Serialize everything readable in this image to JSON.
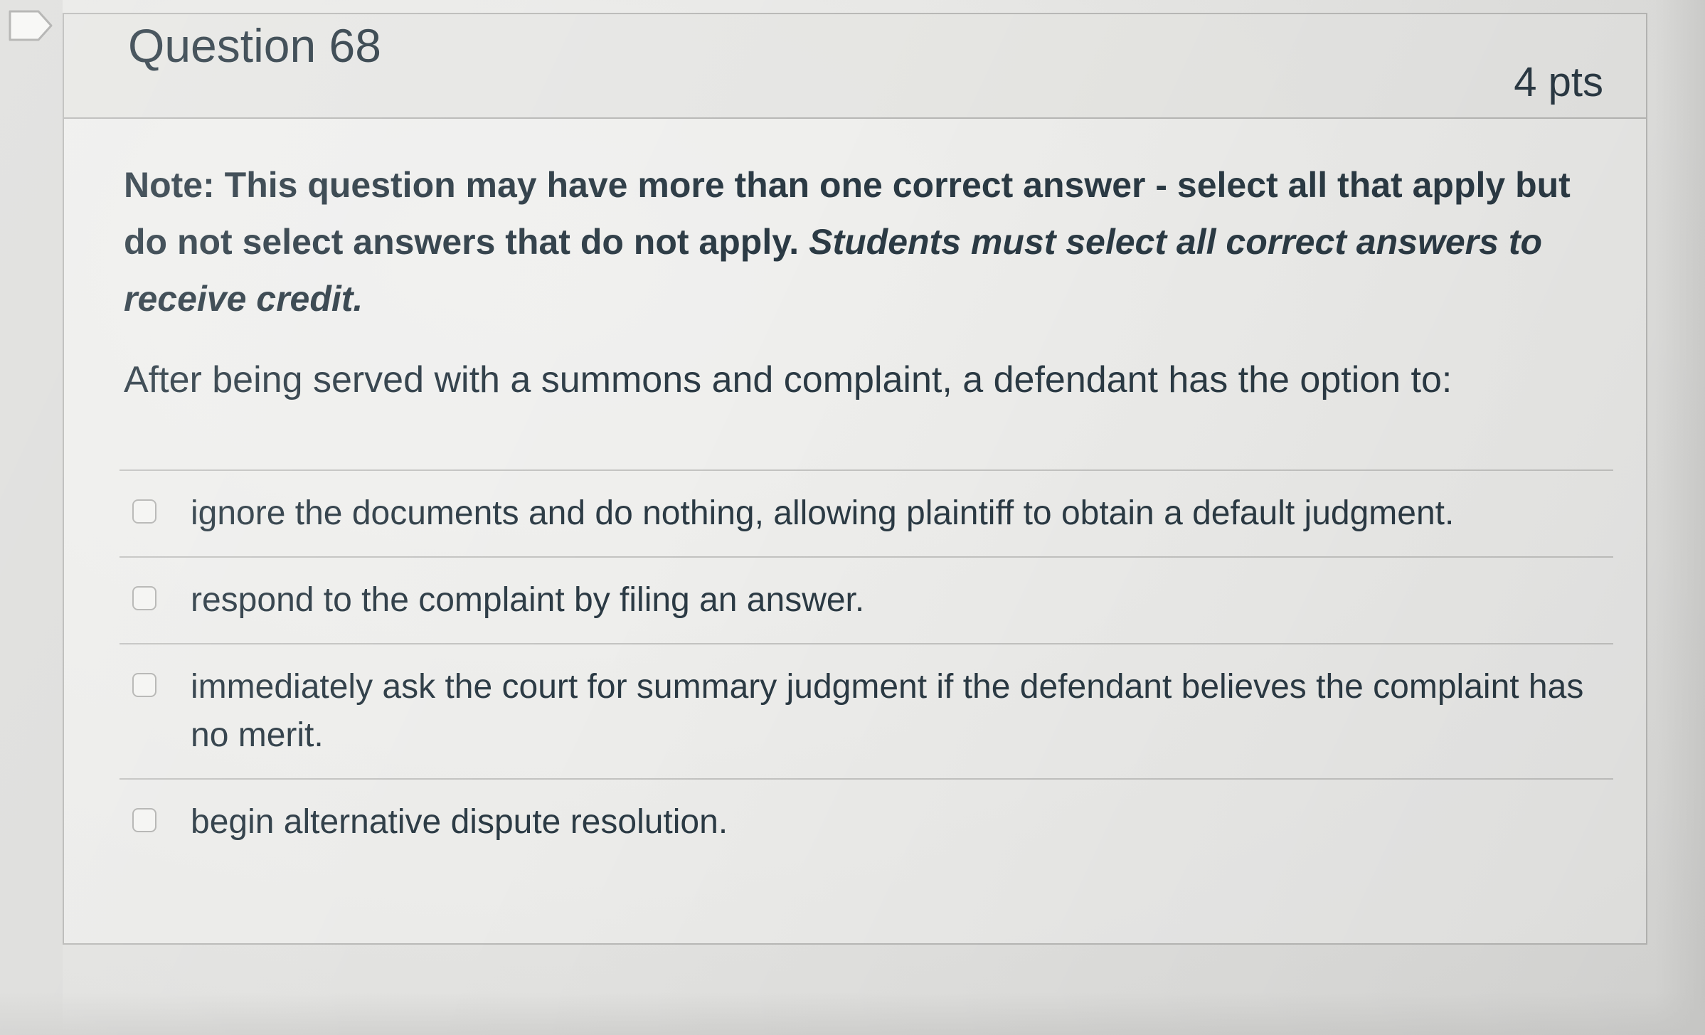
{
  "question": {
    "title": "Question 68",
    "points": "4 pts",
    "note": {
      "bold_lead": "Note:  This question may have more than one correct answer - select all that apply but do not select answers that do not apply.",
      "bold_italic": "Students must select all correct answers to receive credit."
    },
    "prompt": "After being served with a summons and complaint, a defendant has the option to:",
    "answers": [
      {
        "label": "ignore the documents and do nothing, allowing plaintiff to obtain a default judgment.",
        "checked": false
      },
      {
        "label": "respond to the complaint by filing an answer.",
        "checked": false
      },
      {
        "label": "immediately ask the court for summary judgment if the defendant believes the complaint has no merit.",
        "checked": false
      },
      {
        "label": "begin alternative dispute resolution.",
        "checked": false
      }
    ]
  },
  "icons": {
    "flag": "bookmark-flag-icon",
    "checkbox": "checkbox-unchecked-icon"
  },
  "colors": {
    "text": "#2b3a44",
    "border": "#b9b9b7",
    "background": "#e6e6e4"
  }
}
